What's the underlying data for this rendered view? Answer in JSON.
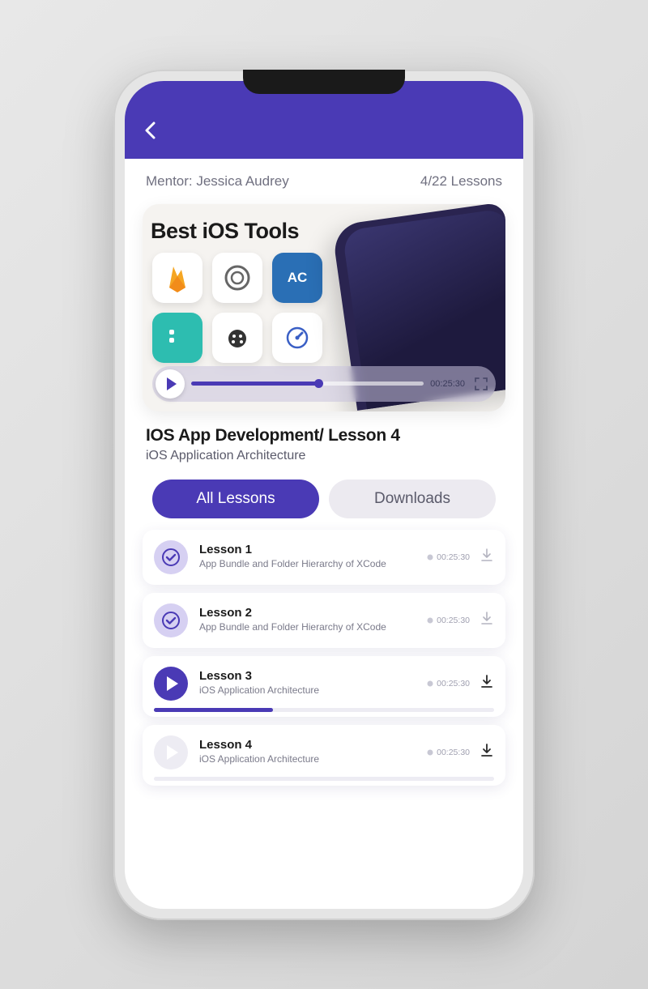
{
  "header": {
    "mentor_label": "Mentor: Jessica Audrey",
    "progress_label": "4/22 Lessons"
  },
  "hero": {
    "title": "Best iOS Tools",
    "icons": [
      "firebase",
      "circle-app",
      "appcode",
      "teal-app",
      "ladybug",
      "speedometer"
    ],
    "player_time": "00:25:30"
  },
  "course": {
    "title": "IOS App Development/ Lesson 4",
    "subtitle": "iOS Application Architecture"
  },
  "tabs": {
    "all_lessons": "All Lessons",
    "downloads": "Downloads"
  },
  "lessons": [
    {
      "title": "Lesson 1",
      "desc": "App Bundle and Folder Hierarchy of XCode",
      "time": "00:25:30",
      "status": "done",
      "progress": null
    },
    {
      "title": "Lesson 2",
      "desc": "App Bundle and Folder Hierarchy of XCode",
      "time": "00:25:30",
      "status": "done",
      "progress": null
    },
    {
      "title": "Lesson 3",
      "desc": "iOS Application Architecture",
      "time": "00:25:30",
      "status": "playing",
      "progress": 35
    },
    {
      "title": "Lesson 4",
      "desc": "iOS Application Architecture",
      "time": "00:25:30",
      "status": "idle",
      "progress": 0
    }
  ],
  "colors": {
    "accent": "#4a3ab5"
  }
}
